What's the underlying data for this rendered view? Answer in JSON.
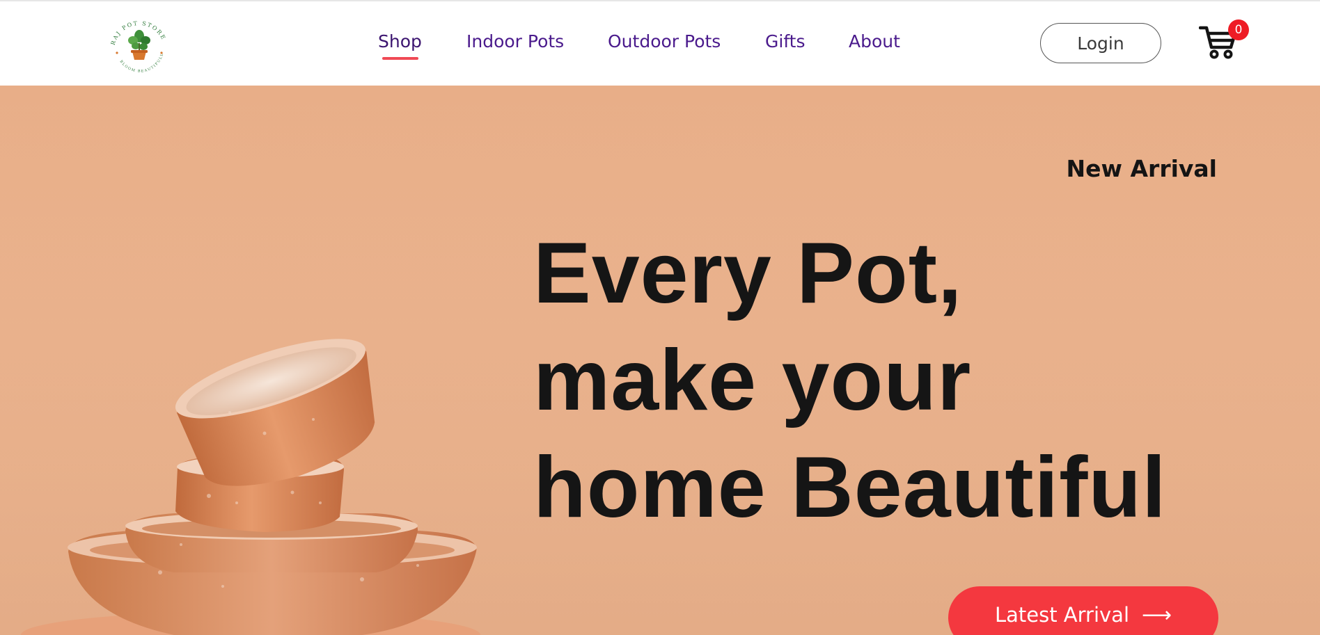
{
  "brand": {
    "name": "RAJ POT STORE",
    "tagline": "BLOOM BEAUTIFULLY",
    "logo_icon": "potted-plant-icon"
  },
  "nav": {
    "items": [
      {
        "label": "Shop",
        "active": true
      },
      {
        "label": "Indoor Pots",
        "active": false
      },
      {
        "label": "Outdoor Pots",
        "active": false
      },
      {
        "label": "Gifts",
        "active": false
      },
      {
        "label": "About",
        "active": false
      }
    ]
  },
  "header": {
    "login_label": "Login",
    "cart_icon": "shopping-cart-icon",
    "cart_count": "0"
  },
  "hero": {
    "eyebrow": "New Arrival",
    "headline_lines": [
      "Every Pot,",
      "make your",
      "home Beautiful"
    ],
    "cta_label": "Latest Arrival",
    "cta_icon": "arrow-right-icon"
  },
  "colors": {
    "nav_text": "#4a1a8c",
    "active_underline": "#f04a55",
    "hero_background": "#ebb48f",
    "cta_background": "#f4383f",
    "badge_background": "#ee1c25"
  }
}
